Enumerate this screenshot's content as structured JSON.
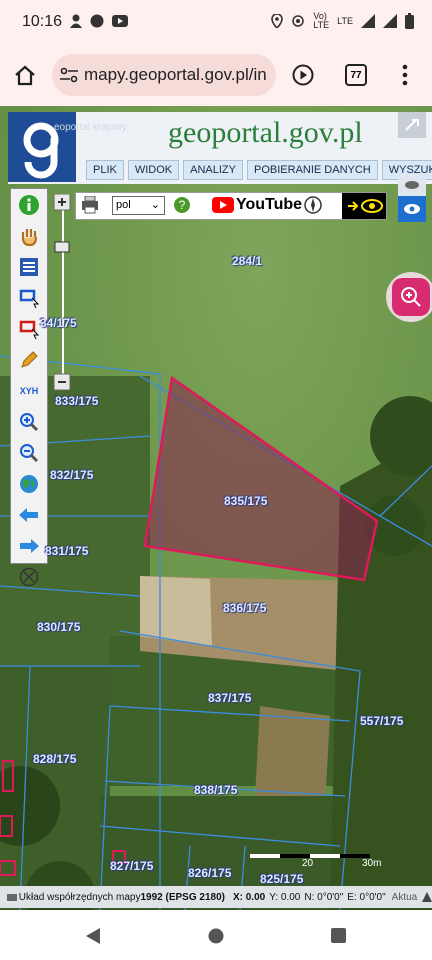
{
  "status": {
    "time": "10:16",
    "network": "LTE"
  },
  "browser": {
    "url": "mapy.geoportal.gov.pl/in",
    "tab_count": "77"
  },
  "geoportal": {
    "header_small": "eoportal krajowy",
    "site_name_main": "geoportal.gov.pl",
    "menu": [
      "PLIK",
      "WIDOK",
      "ANALIZY",
      "POBIERANIE DANYCH",
      "WYSZUKIWAN"
    ],
    "language": "pol",
    "youtube": "YouTube",
    "tool_xyh": "XYH"
  },
  "parcels": [
    {
      "id": "284/1"
    },
    {
      "id": "34/175"
    },
    {
      "id": "833/175"
    },
    {
      "id": "832/175"
    },
    {
      "id": "835/175"
    },
    {
      "id": "831/175"
    },
    {
      "id": "836/175"
    },
    {
      "id": "830/175"
    },
    {
      "id": "837/175"
    },
    {
      "id": "557/175"
    },
    {
      "id": "828/175"
    },
    {
      "id": "838/175"
    },
    {
      "id": "827/175"
    },
    {
      "id": "826/175"
    },
    {
      "id": "825/175"
    }
  ],
  "scale": {
    "label_20": "20",
    "label_30": "30m"
  },
  "coords": {
    "system_label": "Układ współrzędnych mapy ",
    "system_value": "1992 (EPSG 2180)",
    "x": "X: 0.00",
    "y": "Y: 0.00",
    "n": "N: 0°0'0\"",
    "e": "E: 0°0'0\"",
    "aktual": "Aktua"
  },
  "colors": {
    "selection": "#e0195a",
    "parcel_line": "#3c8ce0",
    "header_blue": "#1f4c96"
  }
}
